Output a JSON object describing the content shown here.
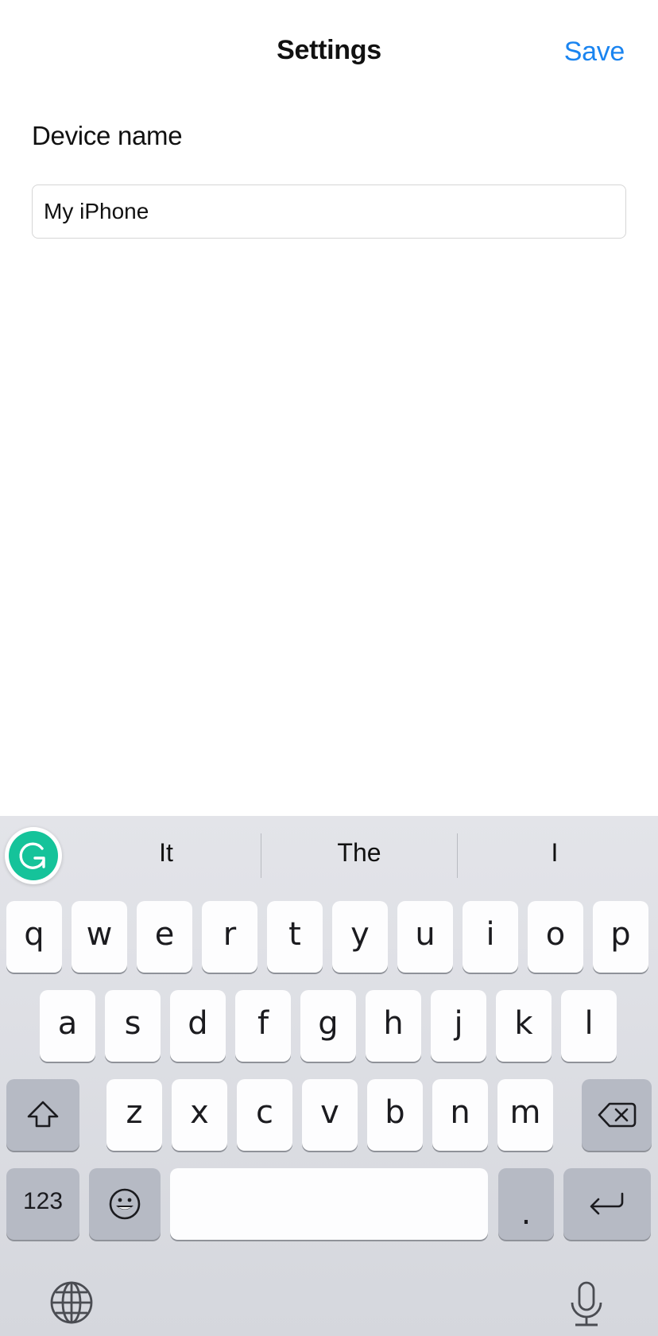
{
  "nav": {
    "title": "Settings",
    "save_label": "Save",
    "accent_color": "#1a84f0"
  },
  "form": {
    "label": "Device name",
    "input_value": "My iPhone"
  },
  "keyboard": {
    "suggestions": [
      "It",
      "The",
      "I"
    ],
    "grammarly_icon": "grammarly-g-icon",
    "row1": [
      "q",
      "w",
      "e",
      "r",
      "t",
      "y",
      "u",
      "i",
      "o",
      "p"
    ],
    "row2": [
      "a",
      "s",
      "d",
      "f",
      "g",
      "h",
      "j",
      "k",
      "l"
    ],
    "row3": [
      "z",
      "x",
      "c",
      "v",
      "b",
      "n",
      "m"
    ],
    "numbers_label": "123",
    "period_label": ".",
    "icons": {
      "shift": "shift-arrow-icon",
      "delete": "backspace-icon",
      "emoji": "emoji-smiley-icon",
      "return": "return-arrow-icon",
      "globe": "globe-icon",
      "mic": "microphone-icon"
    }
  }
}
